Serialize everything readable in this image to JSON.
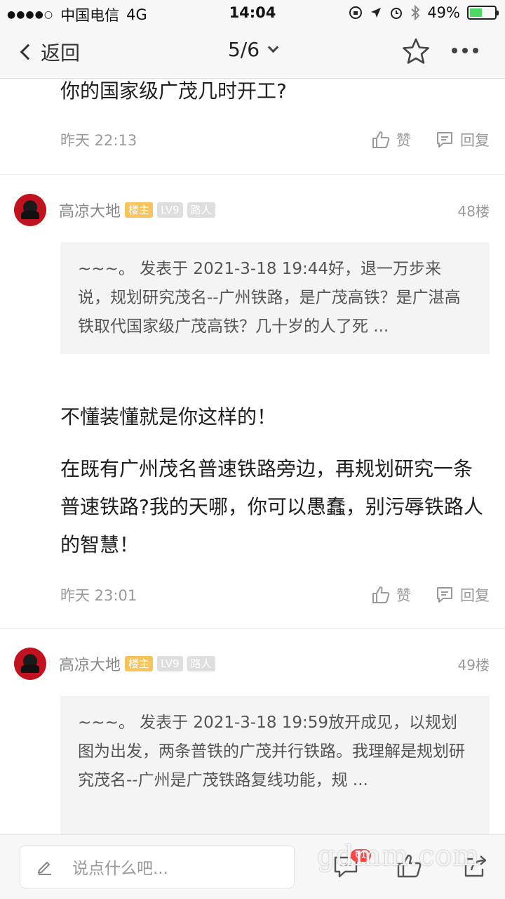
{
  "status_bar": {
    "carrier": "中国电信",
    "network": "4G",
    "time": "14:04",
    "battery": "49%",
    "battery_level": 0.49
  },
  "nav": {
    "back_label": "返回",
    "pager": "5/6"
  },
  "previous_post": {
    "text": "你的国家级广茂几时开工?",
    "time": "昨天 22:13",
    "like_label": "赞",
    "reply_label": "回复"
  },
  "replies": [
    {
      "username": "高凉大地",
      "badges": [
        "楼主",
        "LV9",
        "路人"
      ],
      "floor": "48楼",
      "quote": "~~~。 发表于 2021-3-18 19:44好，退一万步来说，规划研究茂名--广州铁路，是广茂高铁？是广湛高铁取代国家级广茂高铁？几十岁的人了死 ...",
      "body": [
        "不懂装懂就是你这样的！",
        "在既有广州茂名普速铁路旁边，再规划研究一条普速铁路?我的天哪，你可以愚蠢，别污辱铁路人的智慧！"
      ],
      "time": "昨天 23:01",
      "like_label": "赞",
      "reply_label": "回复"
    },
    {
      "username": "高凉大地",
      "badges": [
        "楼主",
        "LV9",
        "路人"
      ],
      "floor": "49楼",
      "quote": "~~~。 发表于 2021-3-18 19:59放开成见，以规划图为出发，两条普铁的广茂并行铁路。我理解是规划研究茂名--广州是广茂铁路复线功能，规 ..."
    }
  ],
  "bottom_bar": {
    "comment_placeholder": "说点什么吧...",
    "comment_count": "61",
    "watermark": "gdmm.com"
  },
  "colors": {
    "owner_badge": "#f7c45c",
    "grey_badge": "#dedede",
    "battery_fill": "#4cd964",
    "count_badge": "#ff4444"
  },
  "icons": [
    "back-chevron-icon",
    "dropdown-chevron-icon",
    "star-icon",
    "more-icon",
    "thumbs-up-icon",
    "comment-icon",
    "pencil-icon",
    "share-icon"
  ]
}
